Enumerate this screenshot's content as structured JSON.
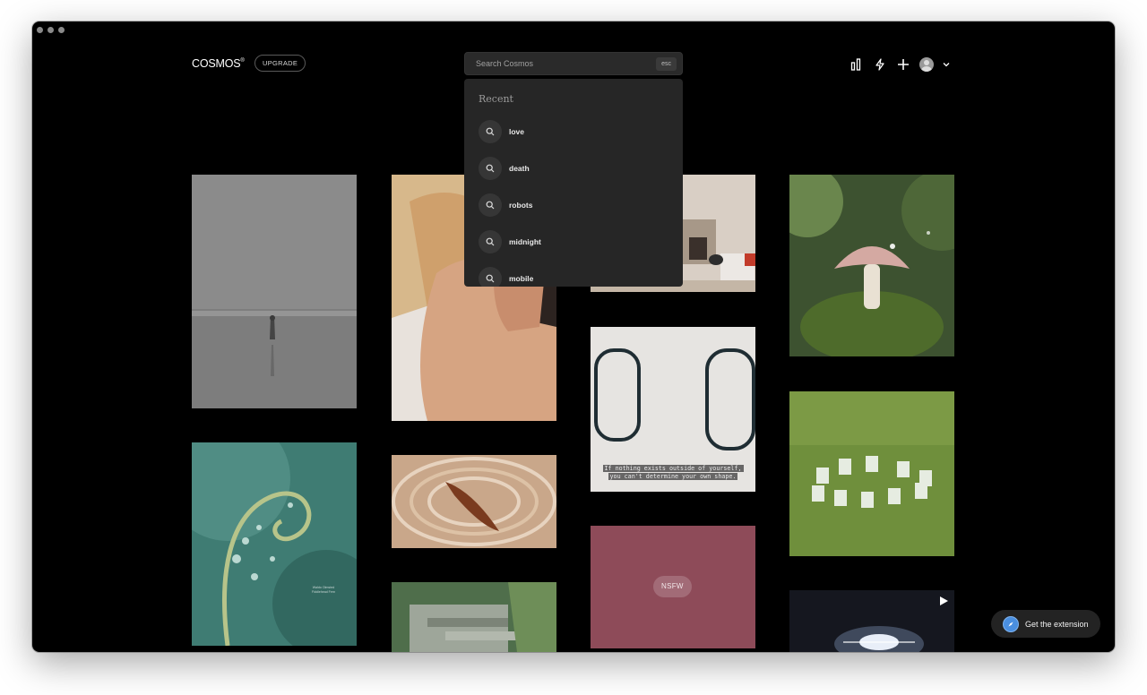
{
  "app": {
    "logo": "COSMOS",
    "logo_mark": "®",
    "upgrade_label": "UPGRADE"
  },
  "search": {
    "placeholder": "Search Cosmos",
    "esc_label": "esc"
  },
  "recent": {
    "title": "Recent",
    "items": [
      "love",
      "death",
      "robots",
      "midnight",
      "mobile"
    ]
  },
  "nav": {
    "icons": [
      "chart-bars-icon",
      "lightning-icon",
      "plus-icon",
      "avatar",
      "chevron-down-icon"
    ]
  },
  "grid": {
    "nsfw_label": "NSFW",
    "quote_line_1": "If nothing exists outside of yourself,",
    "quote_line_2": "you can't determine your own shape.",
    "fern_caption_1": "Waldo Olmsted",
    "fern_caption_2": "Fiddlehead Fern"
  },
  "extension": {
    "label": "Get the extension"
  }
}
